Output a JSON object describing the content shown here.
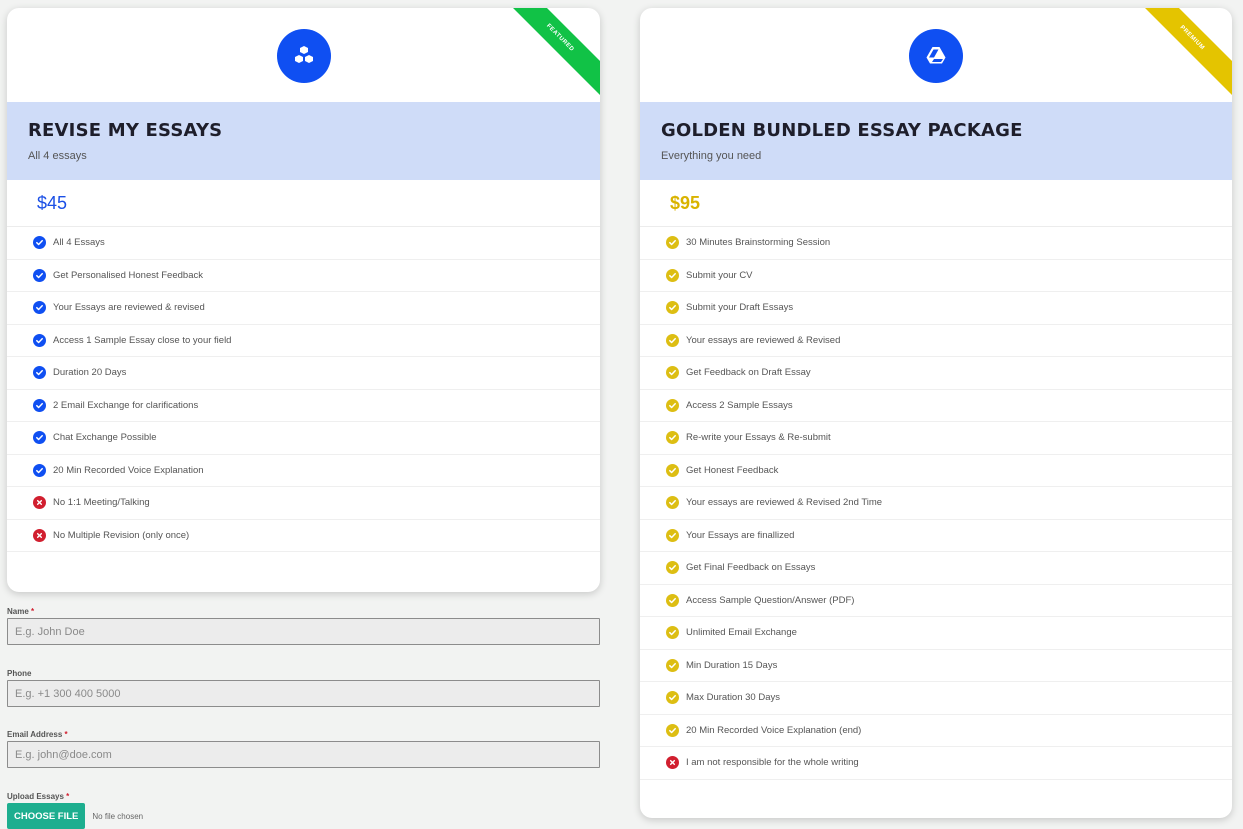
{
  "plans": {
    "left": {
      "ribbon": "FEATURED",
      "icon": "cubes-icon",
      "title": "REVISE MY ESSAYS",
      "subtitle": "All 4 essays",
      "price": "$45",
      "accent": "#0f4ff2",
      "features": [
        {
          "text": "All 4 Essays",
          "included": true
        },
        {
          "text": "Get Personalised Honest Feedback",
          "included": true
        },
        {
          "text": "Your Essays are reviewed & revised",
          "included": true
        },
        {
          "text": "Access 1 Sample Essay close to your field",
          "included": true
        },
        {
          "text": "Duration 20 Days",
          "included": true
        },
        {
          "text": "2 Email Exchange for clarifications",
          "included": true
        },
        {
          "text": "Chat Exchange Possible",
          "included": true
        },
        {
          "text": "20 Min Recorded Voice Explanation",
          "included": true
        },
        {
          "text": "No 1:1 Meeting/Talking",
          "included": false
        },
        {
          "text": "No Multiple Revision (only once)",
          "included": false
        }
      ]
    },
    "right": {
      "ribbon": "PREMIUM",
      "icon": "google-drive-icon",
      "title": "GOLDEN BUNDLED ESSAY PACKAGE",
      "subtitle": "Everything you need",
      "price": "$95",
      "accent": "#ddbe13",
      "features": [
        {
          "text": "30 Minutes Brainstorming Session",
          "included": true
        },
        {
          "text": "Submit your CV",
          "included": true
        },
        {
          "text": "Submit your Draft Essays",
          "included": true
        },
        {
          "text": "Your essays are reviewed & Revised",
          "included": true
        },
        {
          "text": "Get Feedback on Draft Essay",
          "included": true
        },
        {
          "text": "Access 2 Sample Essays",
          "included": true
        },
        {
          "text": "Re-write your Essays & Re-submit",
          "included": true
        },
        {
          "text": "Get Honest Feedback",
          "included": true
        },
        {
          "text": "Your essays are reviewed & Revised 2nd Time",
          "included": true
        },
        {
          "text": "Your Essays are finallized",
          "included": true
        },
        {
          "text": "Get Final Feedback on Essays",
          "included": true
        },
        {
          "text": "Access Sample Question/Answer (PDF)",
          "included": true
        },
        {
          "text": "Unlimited Email Exchange",
          "included": true
        },
        {
          "text": "Min Duration 15 Days",
          "included": true
        },
        {
          "text": "Max Duration 30 Days",
          "included": true
        },
        {
          "text": "20 Min Recorded Voice Explanation (end)",
          "included": true
        },
        {
          "text": "I am not responsible for the whole writing",
          "included": false
        }
      ]
    }
  },
  "form": {
    "name": {
      "label": "Name",
      "required": "*",
      "placeholder": "E.g. John Doe"
    },
    "phone": {
      "label": "Phone",
      "placeholder": "E.g. +1 300 400 5000"
    },
    "email": {
      "label": "Email Address",
      "required": "*",
      "placeholder": "E.g. john@doe.com"
    },
    "upload": {
      "label": "Upload Essays",
      "required": "*",
      "button": "CHOOSE FILE",
      "status": "No file chosen"
    }
  },
  "colors": {
    "excluded": "#d11f2f",
    "upload_button": "#1dae8f",
    "header_band": "#cfdcf8"
  }
}
